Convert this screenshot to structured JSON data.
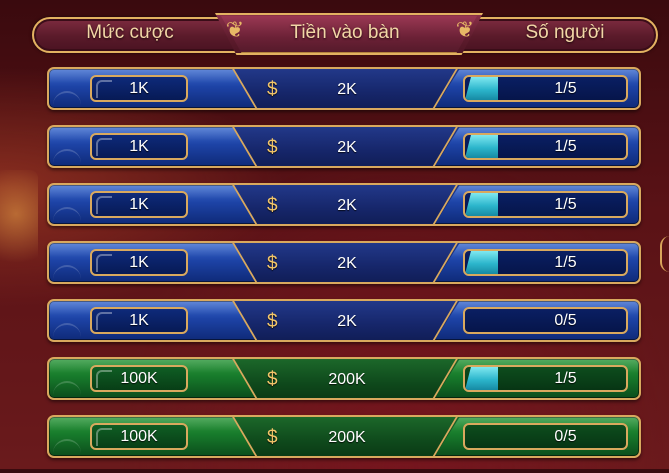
{
  "header": {
    "col_bet": "Mức cược",
    "col_entry": "Tiền vào bàn",
    "col_players": "Số người"
  },
  "colors": {
    "gold": "#d9a95e",
    "blue_row": "#1d43a6",
    "green_row": "#177a2b",
    "fill_cyan": "#2cb6cc",
    "header_maroon": "#5a1a2a"
  },
  "currency_symbol": "$",
  "rows": [
    {
      "bet": "1K",
      "entry": "2K",
      "players": "1/5",
      "fill": 0.2,
      "tier": "blue"
    },
    {
      "bet": "1K",
      "entry": "2K",
      "players": "1/5",
      "fill": 0.2,
      "tier": "blue"
    },
    {
      "bet": "1K",
      "entry": "2K",
      "players": "1/5",
      "fill": 0.2,
      "tier": "blue"
    },
    {
      "bet": "1K",
      "entry": "2K",
      "players": "1/5",
      "fill": 0.2,
      "tier": "blue"
    },
    {
      "bet": "1K",
      "entry": "2K",
      "players": "0/5",
      "fill": 0.0,
      "tier": "blue"
    },
    {
      "bet": "100K",
      "entry": "200K",
      "players": "1/5",
      "fill": 0.2,
      "tier": "green"
    },
    {
      "bet": "100K",
      "entry": "200K",
      "players": "0/5",
      "fill": 0.0,
      "tier": "green"
    }
  ]
}
